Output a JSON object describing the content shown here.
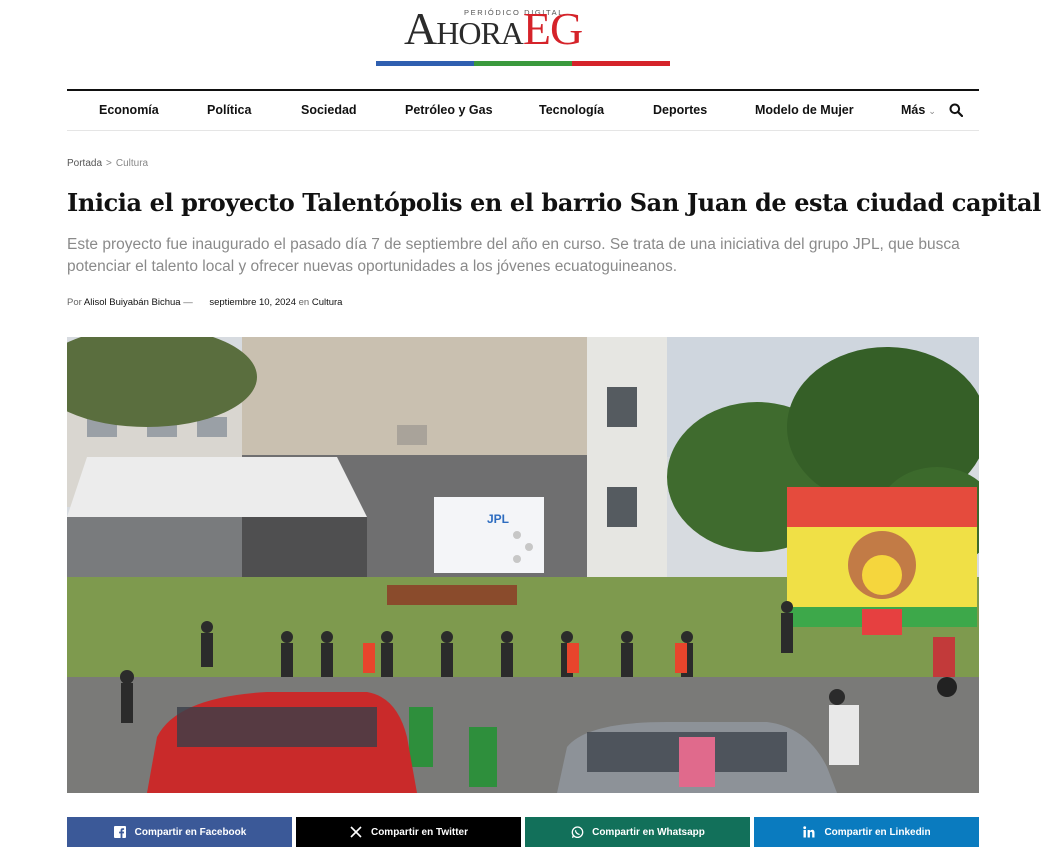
{
  "logo": {
    "tagline": "PERIÓDICO DIGITAL",
    "name_part1": "Ahora",
    "name_part2": "EG",
    "bar_colors": [
      "#2f5fb0",
      "#3b9a3d",
      "#d5232a"
    ]
  },
  "nav": {
    "items": [
      "Economía",
      "Política",
      "Sociedad",
      "Petróleo y Gas",
      "Tecnología",
      "Deportes",
      "Modelo de Mujer"
    ],
    "more_label": "Más",
    "search_icon": "search-icon"
  },
  "breadcrumb": {
    "home": "Portada",
    "separator": ">",
    "category": "Cultura"
  },
  "article": {
    "title": "Inicia el proyecto Talentópolis en el barrio San Juan de esta ciudad capital",
    "subtitle": "Este proyecto fue inaugurado el pasado día 7 de septiembre del año en curso. Se trata de una iniciativa del grupo JPL, que busca potenciar el talento local y ofrecer nuevas oportunidades a los jóvenes ecuatoguineanos.",
    "meta": {
      "by_label": "Por",
      "author": "Alisol Buiyabán Bichua",
      "dash": "—",
      "date": "septiembre 10, 2024",
      "in_label": "en",
      "category": "Cultura"
    },
    "photo_banner_text": "JPL"
  },
  "share": {
    "facebook": "Compartir en Facebook",
    "twitter": "Compartir en Twitter",
    "whatsapp": "Compartir en Whatsapp",
    "linkedin": "Compartir en Linkedin",
    "colors": {
      "facebook": "#3b5998",
      "twitter": "#000000",
      "whatsapp": "#12705a",
      "linkedin": "#0a7bbf"
    }
  }
}
